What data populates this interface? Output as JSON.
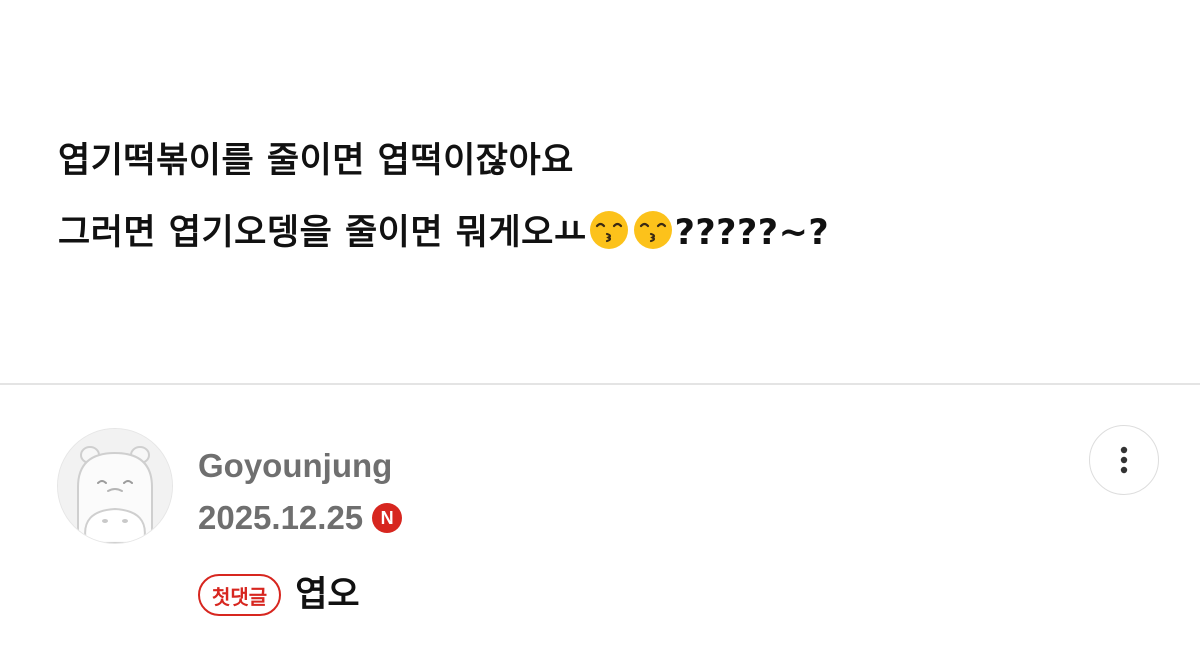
{
  "post": {
    "line1": "엽기떡볶이를 줄이면 엽떡이잖아요",
    "line2_text": "그러면 엽기오뎅을 줄이면 뭐게오ㅛ",
    "line2_suffix": "?????~?",
    "emoji_icon": "kissing-face-with-smiling-eyes"
  },
  "comment": {
    "author": "Goyounjung",
    "date": "2025.12.25",
    "new_badge": "N",
    "first_comment_badge": "첫댓글",
    "text": "엽오",
    "avatar_icon": "hippo-avatar",
    "more_icon": "vertical-ellipsis"
  },
  "colors": {
    "accent": "#d7261f",
    "meta_text": "#6f6f6f",
    "divider": "#e4e4e4"
  }
}
